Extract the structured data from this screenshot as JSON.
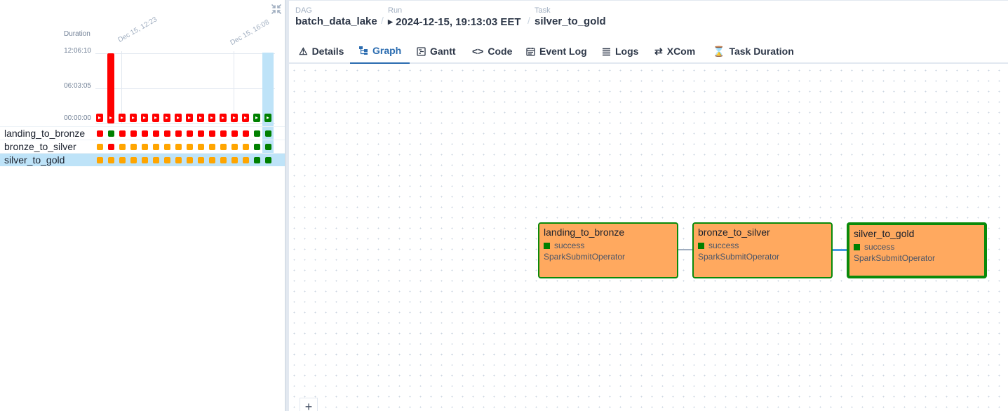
{
  "grid": {
    "duration_label": "Duration",
    "y_ticks": [
      "12:06:10",
      "06:03:05",
      "00:00:00"
    ],
    "x_ticks": [
      "Dec 15, 12:23",
      "Dec 15, 16:08"
    ],
    "runs": [
      {
        "state": "failed",
        "duration_fraction": 0.0
      },
      {
        "state": "failed",
        "duration_fraction": 1.0
      },
      {
        "state": "failed",
        "duration_fraction": 0.0
      },
      {
        "state": "failed",
        "duration_fraction": 0.0
      },
      {
        "state": "failed",
        "duration_fraction": 0.0
      },
      {
        "state": "failed",
        "duration_fraction": 0.0
      },
      {
        "state": "failed",
        "duration_fraction": 0.0
      },
      {
        "state": "failed",
        "duration_fraction": 0.0
      },
      {
        "state": "failed",
        "duration_fraction": 0.0
      },
      {
        "state": "failed",
        "duration_fraction": 0.0
      },
      {
        "state": "failed",
        "duration_fraction": 0.0
      },
      {
        "state": "failed",
        "duration_fraction": 0.0
      },
      {
        "state": "failed",
        "duration_fraction": 0.0
      },
      {
        "state": "failed",
        "duration_fraction": 0.0
      },
      {
        "state": "success",
        "duration_fraction": 0.0
      },
      {
        "state": "success",
        "duration_fraction": 0.0
      }
    ],
    "tasks": [
      {
        "name": "landing_to_bronze",
        "states": [
          "failed",
          "success",
          "failed",
          "failed",
          "failed",
          "failed",
          "failed",
          "failed",
          "failed",
          "failed",
          "failed",
          "failed",
          "failed",
          "failed",
          "success",
          "success"
        ]
      },
      {
        "name": "bronze_to_silver",
        "states": [
          "upstream_failed",
          "failed",
          "upstream_failed",
          "upstream_failed",
          "upstream_failed",
          "upstream_failed",
          "upstream_failed",
          "upstream_failed",
          "upstream_failed",
          "upstream_failed",
          "upstream_failed",
          "upstream_failed",
          "upstream_failed",
          "upstream_failed",
          "success",
          "success"
        ]
      },
      {
        "name": "silver_to_gold",
        "states": [
          "upstream_failed",
          "upstream_failed",
          "upstream_failed",
          "upstream_failed",
          "upstream_failed",
          "upstream_failed",
          "upstream_failed",
          "upstream_failed",
          "upstream_failed",
          "upstream_failed",
          "upstream_failed",
          "upstream_failed",
          "upstream_failed",
          "upstream_failed",
          "success",
          "success"
        ]
      }
    ],
    "selected_task": "silver_to_gold"
  },
  "colors": {
    "failed": "#ff0000",
    "success": "#008000",
    "upstream_failed": "#ffa500",
    "selection": "#bee3f8",
    "node_fill": "#ffa95f",
    "active_tab": "#2b6cb0"
  },
  "breadcrumb": {
    "dag_label": "DAG",
    "dag_value": "batch_data_lake",
    "run_label": "Run",
    "run_value": "2024-12-15, 19:13:03 EET",
    "task_label": "Task",
    "task_value": "silver_to_gold"
  },
  "tabs": [
    {
      "label": "Details",
      "icon": "warning-icon"
    },
    {
      "label": "Graph",
      "icon": "graph-icon",
      "active": true
    },
    {
      "label": "Gantt",
      "icon": "gantt-icon"
    },
    {
      "label": "Code",
      "icon": "code-icon"
    },
    {
      "label": "Event Log",
      "icon": "event-log-icon"
    },
    {
      "label": "Logs",
      "icon": "logs-icon"
    },
    {
      "label": "XCom",
      "icon": "xcom-icon"
    },
    {
      "label": "Task Duration",
      "icon": "hourglass-icon"
    }
  ],
  "graph": {
    "nodes": [
      {
        "title": "landing_to_bronze",
        "state": "success",
        "operator": "SparkSubmitOperator"
      },
      {
        "title": "bronze_to_silver",
        "state": "success",
        "operator": "SparkSubmitOperator"
      },
      {
        "title": "silver_to_gold",
        "state": "success",
        "operator": "SparkSubmitOperator",
        "selected": true
      }
    ],
    "zoom_in_label": "+"
  }
}
